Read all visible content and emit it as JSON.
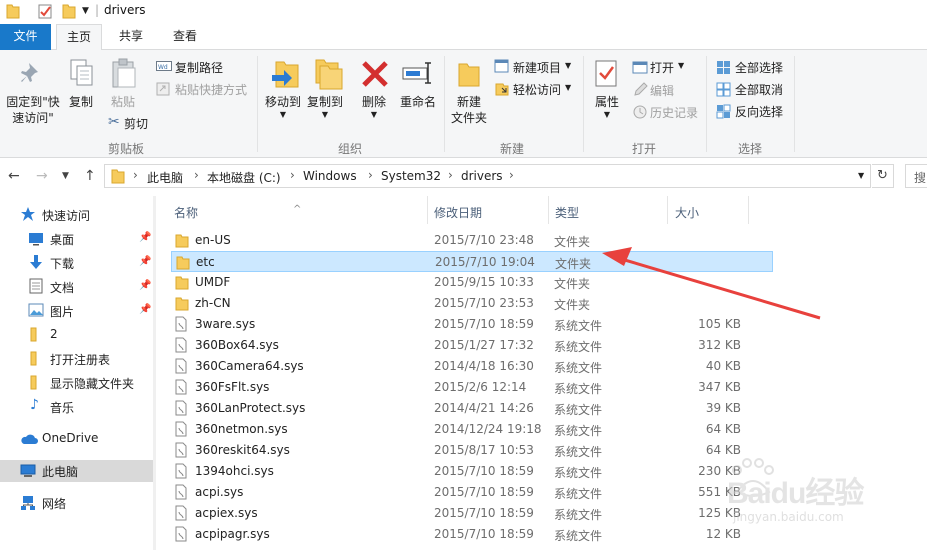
{
  "window": {
    "title": "drivers"
  },
  "ribbon_tabs": {
    "file": "文件",
    "home": "主页",
    "share": "共享",
    "view": "查看"
  },
  "ribbon": {
    "clipboard": {
      "label": "剪贴板",
      "pin_line1": "固定到\"快",
      "pin_line2": "速访问\"",
      "copy": "复制",
      "paste": "粘贴",
      "copy_path": "复制路径",
      "paste_shortcut": "粘贴快捷方式",
      "cut": "剪切"
    },
    "organize": {
      "label": "组织",
      "move_to": "移动到",
      "copy_to": "复制到",
      "delete": "删除",
      "rename": "重命名"
    },
    "new": {
      "label": "新建",
      "new_item": "新建项目",
      "easy_access": "轻松访问",
      "new_folder_line1": "新建",
      "new_folder_line2": "文件夹"
    },
    "open": {
      "label": "打开",
      "properties": "属性",
      "open": "打开",
      "edit": "编辑",
      "history": "历史记录"
    },
    "select": {
      "label": "选择",
      "select_all": "全部选择",
      "select_none": "全部取消",
      "invert": "反向选择"
    }
  },
  "address": {
    "crumbs": [
      "此电脑",
      "本地磁盘 (C:)",
      "Windows",
      "System32",
      "drivers"
    ],
    "search_placeholder": "搜"
  },
  "nav": {
    "quick_access": "快速访问",
    "items": [
      {
        "label": "桌面",
        "icon": "desktop-icon",
        "pinned": true
      },
      {
        "label": "下载",
        "icon": "download-icon",
        "pinned": true
      },
      {
        "label": "文档",
        "icon": "document-icon",
        "pinned": true
      },
      {
        "label": "图片",
        "icon": "picture-icon",
        "pinned": true
      },
      {
        "label": "2",
        "icon": "folder-icon",
        "pinned": false
      },
      {
        "label": "打开注册表",
        "icon": "folder-icon",
        "pinned": false
      },
      {
        "label": "显示隐藏文件夹",
        "icon": "folder-icon",
        "pinned": false
      },
      {
        "label": "音乐",
        "icon": "music-icon",
        "pinned": false
      }
    ],
    "onedrive": "OneDrive",
    "this_pc": "此电脑",
    "network": "网络"
  },
  "columns": {
    "name": "名称",
    "date": "修改日期",
    "type": "类型",
    "size": "大小"
  },
  "files": [
    {
      "name": "en-US",
      "date": "2015/7/10 23:48",
      "type": "文件夹",
      "size": "",
      "kind": "folder"
    },
    {
      "name": "etc",
      "date": "2015/7/10 19:04",
      "type": "文件夹",
      "size": "",
      "kind": "folder",
      "selected": true
    },
    {
      "name": "UMDF",
      "date": "2015/9/15 10:33",
      "type": "文件夹",
      "size": "",
      "kind": "folder"
    },
    {
      "name": "zh-CN",
      "date": "2015/7/10 23:53",
      "type": "文件夹",
      "size": "",
      "kind": "folder"
    },
    {
      "name": "3ware.sys",
      "date": "2015/7/10 18:59",
      "type": "系统文件",
      "size": "105 KB",
      "kind": "file"
    },
    {
      "name": "360Box64.sys",
      "date": "2015/1/27 17:32",
      "type": "系统文件",
      "size": "312 KB",
      "kind": "file"
    },
    {
      "name": "360Camera64.sys",
      "date": "2014/4/18 16:30",
      "type": "系统文件",
      "size": "40 KB",
      "kind": "file"
    },
    {
      "name": "360FsFlt.sys",
      "date": "2015/2/6 12:14",
      "type": "系统文件",
      "size": "347 KB",
      "kind": "file"
    },
    {
      "name": "360LanProtect.sys",
      "date": "2014/4/21 14:26",
      "type": "系统文件",
      "size": "39 KB",
      "kind": "file"
    },
    {
      "name": "360netmon.sys",
      "date": "2014/12/24 19:18",
      "type": "系统文件",
      "size": "64 KB",
      "kind": "file"
    },
    {
      "name": "360reskit64.sys",
      "date": "2015/8/17 10:53",
      "type": "系统文件",
      "size": "64 KB",
      "kind": "file"
    },
    {
      "name": "1394ohci.sys",
      "date": "2015/7/10 18:59",
      "type": "系统文件",
      "size": "230 KB",
      "kind": "file"
    },
    {
      "name": "acpi.sys",
      "date": "2015/7/10 18:59",
      "type": "系统文件",
      "size": "551 KB",
      "kind": "file"
    },
    {
      "name": "acpiex.sys",
      "date": "2015/7/10 18:59",
      "type": "系统文件",
      "size": "125 KB",
      "kind": "file"
    },
    {
      "name": "acpipagr.sys",
      "date": "2015/7/10 18:59",
      "type": "系统文件",
      "size": "12 KB",
      "kind": "file"
    }
  ],
  "watermark": {
    "brand": "Baidu经验",
    "url": "jingyan.baidu.com"
  },
  "colors": {
    "accent": "#1979ca",
    "selection": "#cce8ff",
    "annotation_arrow": "#e8413d"
  }
}
